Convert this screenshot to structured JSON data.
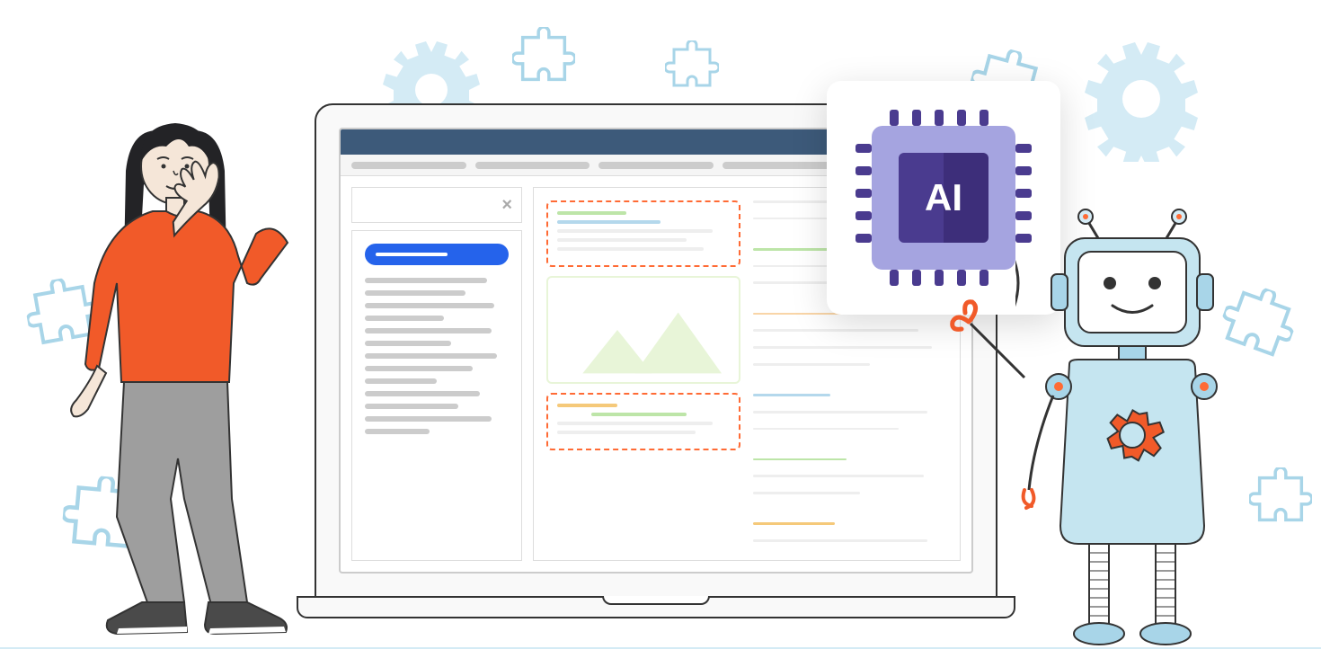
{
  "description": "Illustration of a woman and a robot beside a laptop showing a web page layout with an AI chip card",
  "ai_chip": {
    "label": "AI"
  },
  "colors": {
    "primary_blue": "#2563eb",
    "accent_orange": "#ff6b35",
    "robot_blue": "#a8d5e8",
    "chip_purple": "#4a3b8f",
    "chip_light": "#a5a4e0"
  }
}
